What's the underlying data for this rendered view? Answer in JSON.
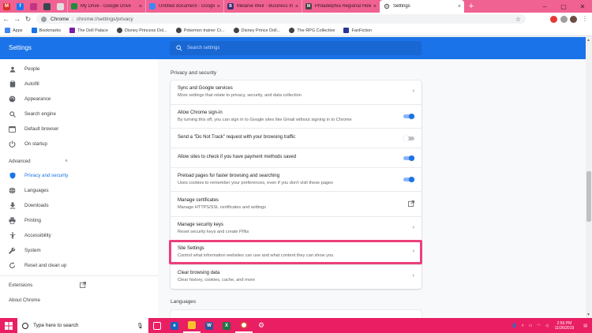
{
  "browser": {
    "tabs": [
      {
        "title": "My Drive - Google Drive",
        "icon": "google-drive-icon",
        "color": "#1e8e3e"
      },
      {
        "title": "Untitled document - Google Docs",
        "icon": "google-docs-icon",
        "color": "#4285f4"
      },
      {
        "title": "Melanie Weir - Business Insider",
        "icon": "business-insider-icon",
        "color": "#3a2f72"
      },
      {
        "title": "Philadelphia Regional Holiday",
        "icon": "mt-icon",
        "color": "#444444"
      },
      {
        "title": "Settings",
        "icon": "gear-icon",
        "color": "#5f6368",
        "active": true
      }
    ],
    "omnibox": {
      "scheme": "Chrome",
      "url": "chrome://settings/privacy"
    },
    "bookmarks": [
      {
        "label": "Apps",
        "color": "#4285f4"
      },
      {
        "label": "Bookmarks",
        "color": "#1a73e8"
      },
      {
        "label": "The Doll Palace",
        "color": "#7b1fa2"
      },
      {
        "label": "Disney Princess Dol...",
        "color": "#444444"
      },
      {
        "label": "Pokemon trainer Cr...",
        "color": "#444444"
      },
      {
        "label": "Disney Prince Doll...",
        "color": "#444444"
      },
      {
        "label": "The RPG Collective",
        "color": "#444444"
      },
      {
        "label": "FanFiction",
        "color": "#283593"
      }
    ]
  },
  "settings": {
    "title": "Settings",
    "search_placeholder": "Search settings",
    "nav": [
      {
        "label": "People",
        "icon": "person-icon"
      },
      {
        "label": "Autofill",
        "icon": "clipboard-icon"
      },
      {
        "label": "Appearance",
        "icon": "palette-icon"
      },
      {
        "label": "Search engine",
        "icon": "search-icon"
      },
      {
        "label": "Default browser",
        "icon": "browser-icon"
      },
      {
        "label": "On startup",
        "icon": "power-icon"
      }
    ],
    "advanced_label": "Advanced",
    "advanced_nav": [
      {
        "label": "Privacy and security",
        "icon": "shield-icon",
        "active": true
      },
      {
        "label": "Languages",
        "icon": "globe-icon"
      },
      {
        "label": "Downloads",
        "icon": "download-icon"
      },
      {
        "label": "Printing",
        "icon": "printer-icon"
      },
      {
        "label": "Accessibility",
        "icon": "accessibility-icon"
      },
      {
        "label": "System",
        "icon": "wrench-icon"
      },
      {
        "label": "Reset and clean up",
        "icon": "reset-icon"
      }
    ],
    "extensions_label": "Extensions",
    "about_label": "About Chrome",
    "section_title": "Privacy and security",
    "rows": [
      {
        "title": "Sync and Google services",
        "subtitle": "More settings that relate to privacy, security, and data collection",
        "control": "chevron"
      },
      {
        "title": "Allow Chrome sign-in",
        "subtitle": "By turning this off, you can sign in to Google sites like Gmail without signing in to Chrome",
        "control": "toggle",
        "on": true
      },
      {
        "title": "Send a \"Do Not Track\" request with your browsing traffic",
        "subtitle": "",
        "control": "toggle",
        "on": false
      },
      {
        "title": "Allow sites to check if you have payment methods saved",
        "subtitle": "",
        "control": "toggle",
        "on": true
      },
      {
        "title": "Preload pages for faster browsing and searching",
        "subtitle": "Uses cookies to remember your preferences, even if you don't visit those pages",
        "control": "toggle",
        "on": true
      },
      {
        "title": "Manage certificates",
        "subtitle": "Manage HTTPS/SSL certificates and settings",
        "control": "external"
      },
      {
        "title": "Manage security keys",
        "subtitle": "Reset security keys and create PINs",
        "control": "chevron"
      },
      {
        "title": "Site Settings",
        "subtitle": "Control what information websites can use and what content they can show you",
        "control": "chevron",
        "highlighted": true
      },
      {
        "title": "Clear browsing data",
        "subtitle": "Clear history, cookies, cache, and more",
        "control": "chevron"
      }
    ],
    "next_section_title": "Languages"
  },
  "taskbar": {
    "search_placeholder": "Type here to search",
    "time": "2:56 PM",
    "date": "11/26/2019",
    "accent": "#e91e63"
  }
}
